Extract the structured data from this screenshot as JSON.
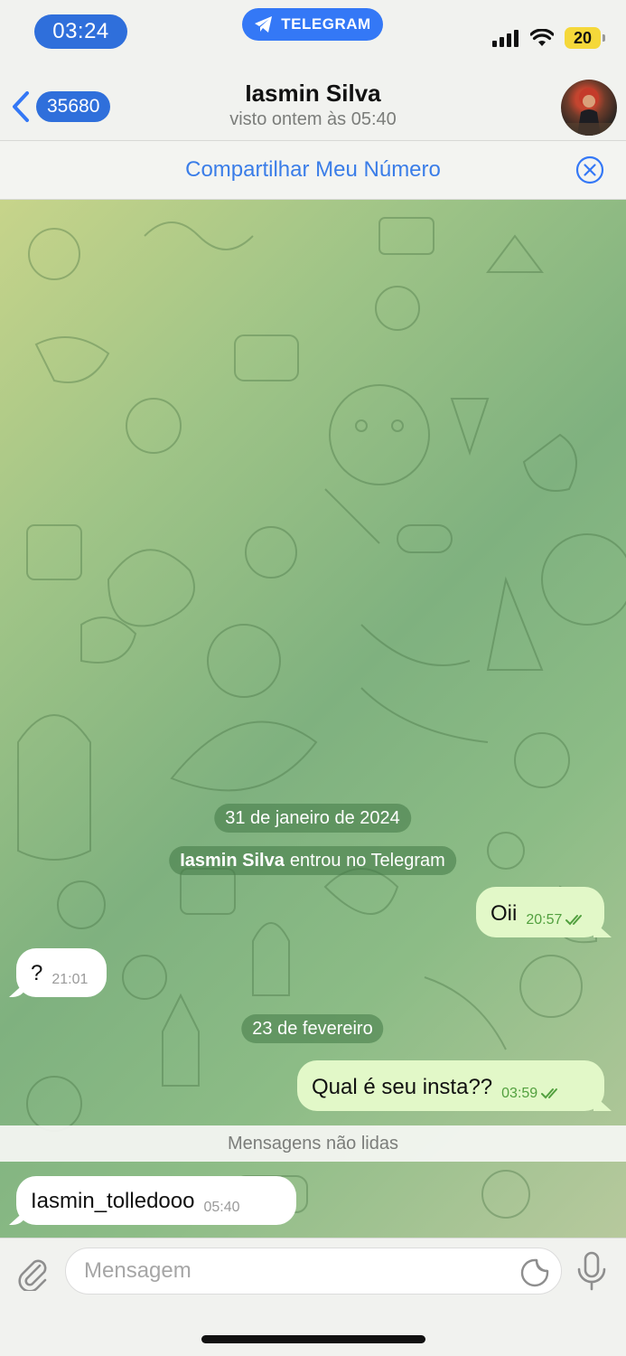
{
  "status_bar": {
    "time": "03:24",
    "app_label": "TELEGRAM",
    "battery": "20"
  },
  "header": {
    "back_count": "35680",
    "contact_name": "Iasmin Silva",
    "contact_status": "visto ontem às 05:40"
  },
  "share_bar": {
    "label": "Compartilhar Meu Número"
  },
  "chat": {
    "date_1": "31 de janeiro de 2024",
    "service_name": "Iasmin Silva",
    "service_text": "entrou no Telegram",
    "date_2": "23 de fevereiro",
    "unread_label": "Mensagens não lidas",
    "messages": [
      {
        "text": "Oii",
        "time": "20:57",
        "direction": "out"
      },
      {
        "text": "?",
        "time": "21:01",
        "direction": "in"
      },
      {
        "text": "Qual é seu insta??",
        "time": "03:59",
        "direction": "out"
      },
      {
        "text": "Iasmin_tolledooo",
        "time": "05:40",
        "direction": "in"
      }
    ]
  },
  "input": {
    "placeholder": "Mensagem"
  },
  "colors": {
    "accent": "#3478f6",
    "out_bubble": "#e2f8c8",
    "in_bubble": "#ffffff",
    "read_check": "#52a03f"
  },
  "icons": [
    "telegram-plane-icon",
    "signal-bars-icon",
    "wifi-icon",
    "battery-icon",
    "chevron-left-icon",
    "close-circle-icon",
    "double-check-icon",
    "paperclip-icon",
    "sticker-icon",
    "microphone-icon"
  ]
}
